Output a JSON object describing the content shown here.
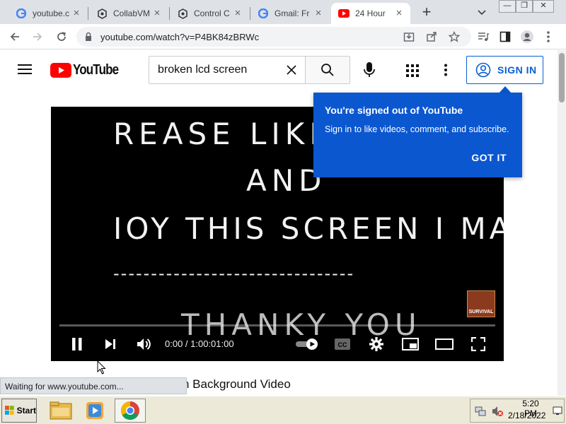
{
  "browser": {
    "tabs": [
      {
        "title": "youtube.c",
        "favicon": "google-icon",
        "active": false
      },
      {
        "title": "CollabVM",
        "favicon": "collabvm-icon",
        "active": false
      },
      {
        "title": "Control C",
        "favicon": "collabvm-icon",
        "active": false
      },
      {
        "title": "Gmail: Fr",
        "favicon": "google-icon",
        "active": false
      },
      {
        "title": "24 Hour",
        "favicon": "youtube-icon",
        "active": true
      }
    ],
    "url": "youtube.com/watch?v=P4BK84zBRWc",
    "window_controls": [
      "—",
      "❐",
      "✕"
    ]
  },
  "youtube": {
    "logo_text": "YouTube",
    "search_query": "broken lcd screen",
    "sign_in_label": "SIGN IN",
    "brand_color": "#ff0000",
    "accent_color": "#065fd4"
  },
  "popup": {
    "title": "You're signed out of YouTube",
    "body": "Sign in to like videos, comment, and subscribe.",
    "button": "GOT IT",
    "color": "#0b57d0"
  },
  "video": {
    "line1": "REASE LIKE, S",
    "line2": "AND",
    "line3": "IOY THIS SCREEN I MADE",
    "line4": "--------------------------------",
    "line5": "THANKY YOU",
    "badge": "SURVIVAL",
    "time_display": "0:00 / 1:00:01:00",
    "played_fraction": 0.0
  },
  "page": {
    "title_fragment": "n Background Video",
    "status_text": "Waiting for www.youtube.com..."
  },
  "taskbar": {
    "start_label": "Start",
    "clock_time": "5:20 PM",
    "clock_date": "2/18/2022"
  }
}
